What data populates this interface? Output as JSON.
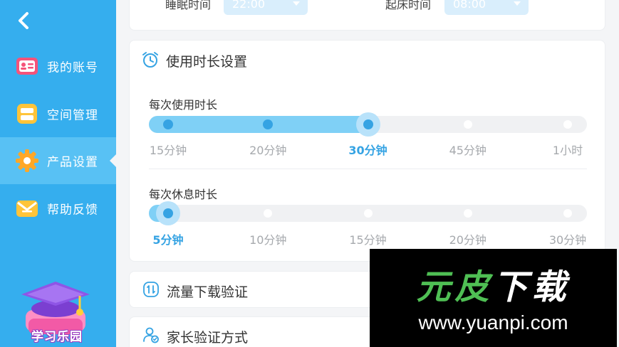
{
  "sidebar": {
    "items": [
      {
        "label": "我的账号",
        "icon": "account-card-icon",
        "active": false
      },
      {
        "label": "空间管理",
        "icon": "storage-icon",
        "active": false
      },
      {
        "label": "产品设置",
        "icon": "gear-icon",
        "active": true
      },
      {
        "label": "帮助反馈",
        "icon": "mail-icon",
        "active": false
      }
    ],
    "mascot_label": "学习乐园"
  },
  "sleep": {
    "sleep_label": "睡眠时间",
    "sleep_value": "22:00",
    "wake_label": "起床时间",
    "wake_value": "08:00"
  },
  "usage": {
    "title": "使用时长设置",
    "per_use": {
      "label": "每次使用时长",
      "ticks": [
        "15分钟",
        "20分钟",
        "30分钟",
        "45分钟",
        "1小时"
      ],
      "selected_index": 2
    },
    "per_rest": {
      "label": "每次休息时长",
      "ticks": [
        "5分钟",
        "10分钟",
        "15分钟",
        "20分钟",
        "30分钟"
      ],
      "selected_index": 0
    }
  },
  "rows": {
    "traffic_title": "流量下载验证",
    "parent_title": "家长验证方式"
  },
  "watermark": {
    "logo_part1": "元皮",
    "logo_part2": "下载",
    "url": "www.yuanpi.com"
  },
  "colors": {
    "sidebar": "#35aeee",
    "sidebar_active": "#58c1f4",
    "accent": "#35a3e3",
    "track_fill": "#7fd0f6",
    "watermark_green": "#4fbf54"
  }
}
